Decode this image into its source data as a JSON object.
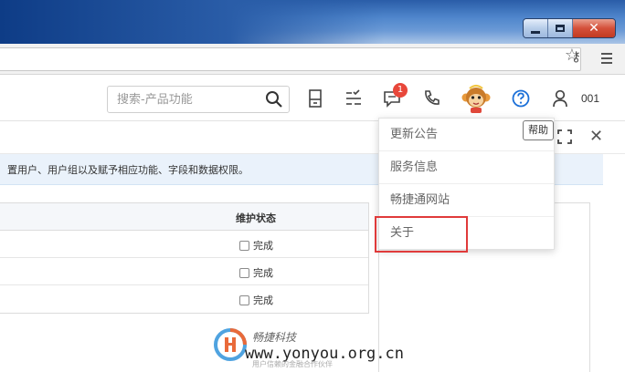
{
  "window": {
    "controls": {
      "minimize": "–",
      "maximize": "□",
      "close": "✕"
    }
  },
  "header": {
    "search_placeholder": "搜索-产品功能",
    "notification_count": "1",
    "user_code": "001",
    "icons": [
      "search-icon",
      "document-icon",
      "task-list-icon",
      "message-icon",
      "phone-icon",
      "monkey-avatar-icon",
      "help-icon",
      "user-icon"
    ]
  },
  "page": {
    "description": "置用户、用户组以及赋予相应功能、字段和数据权限。",
    "table": {
      "header": "维护状态",
      "rows": [
        {
          "status": "完成"
        },
        {
          "status": "完成"
        },
        {
          "status": "完成"
        }
      ]
    }
  },
  "help_menu": {
    "items": [
      {
        "label": "更新公告"
      },
      {
        "label": "服务信息"
      },
      {
        "label": "畅捷通网站"
      },
      {
        "label": "关于"
      }
    ],
    "tooltip": "帮助",
    "highlight_color": "#e03a3a"
  },
  "watermark": {
    "brand": "畅捷科技",
    "url": "www.yonyou.org.cn",
    "sub": "用户信赖的金融合作伙伴"
  },
  "colors": {
    "accent_blue": "#1a6fd8",
    "badge_red": "#e8473a"
  }
}
